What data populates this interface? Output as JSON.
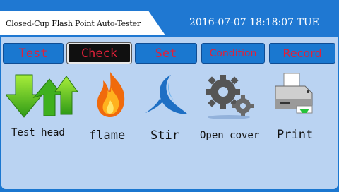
{
  "header": {
    "title": "Closed-Cup Flash Point Auto-Tester",
    "datetime": "2016-07-07  18:18:07 TUE"
  },
  "tabs": [
    {
      "label": "Test",
      "active": false
    },
    {
      "label": "Check",
      "active": true
    },
    {
      "label": "Set",
      "active": false
    },
    {
      "label": "Condition",
      "active": false
    },
    {
      "label": "Record",
      "active": false
    }
  ],
  "controls": [
    {
      "label": "Test head",
      "icon": "arrows-icon"
    },
    {
      "label": "flame",
      "icon": "flame-icon"
    },
    {
      "label": "Stir",
      "icon": "stir-icon"
    },
    {
      "label": "Open cover",
      "icon": "gears-icon"
    },
    {
      "label": "Print",
      "icon": "printer-icon"
    }
  ],
  "colors": {
    "frame": "#1f78d2",
    "panel": "#bad3f2",
    "tab_text": "#e0213a",
    "active_tab": "#101010"
  }
}
